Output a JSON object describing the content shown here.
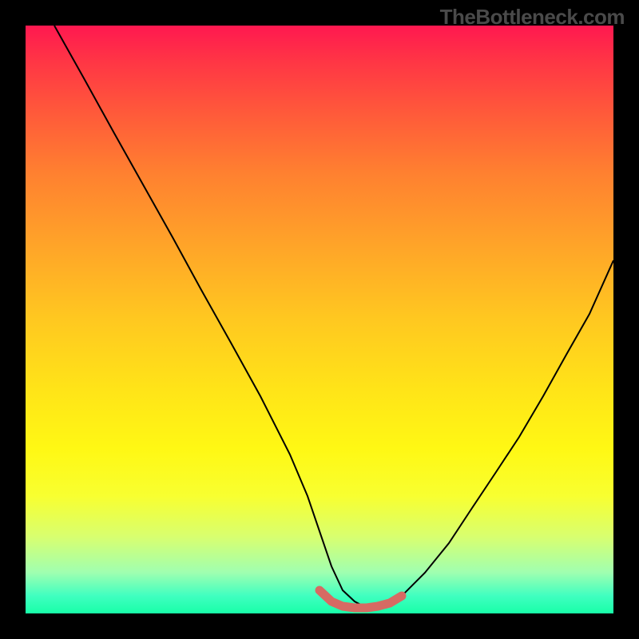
{
  "watermark": "TheBottleneck.com",
  "chart_data": {
    "type": "line",
    "title": "",
    "xlabel": "",
    "ylabel": "",
    "x_range": [
      0,
      100
    ],
    "y_range": [
      0,
      100
    ],
    "series": [
      {
        "name": "bottleneck-curve",
        "x": [
          5,
          10,
          15,
          20,
          25,
          30,
          35,
          40,
          45,
          48,
          50,
          52,
          54,
          56,
          58,
          60,
          62,
          64,
          68,
          72,
          76,
          80,
          84,
          88,
          92,
          96,
          100
        ],
        "values": [
          100,
          91,
          82,
          73,
          64,
          55,
          46,
          37,
          27,
          20,
          14,
          8,
          4,
          2,
          1,
          1,
          2,
          3,
          7,
          12,
          18,
          24,
          30,
          37,
          44,
          51,
          60
        ]
      },
      {
        "name": "optimal-highlight",
        "x": [
          50,
          52,
          54,
          56,
          58,
          60,
          62,
          64
        ],
        "values": [
          4,
          2,
          1.2,
          1,
          1,
          1.2,
          1.8,
          3
        ]
      }
    ],
    "colors": {
      "curve": "#000000",
      "highlight": "#d66a63"
    },
    "gradient_stops": [
      {
        "pos": 0.0,
        "color": "#ff1850"
      },
      {
        "pos": 0.5,
        "color": "#ffe020"
      },
      {
        "pos": 0.95,
        "color": "#c0ff80"
      },
      {
        "pos": 1.0,
        "color": "#18ffa8"
      }
    ]
  }
}
